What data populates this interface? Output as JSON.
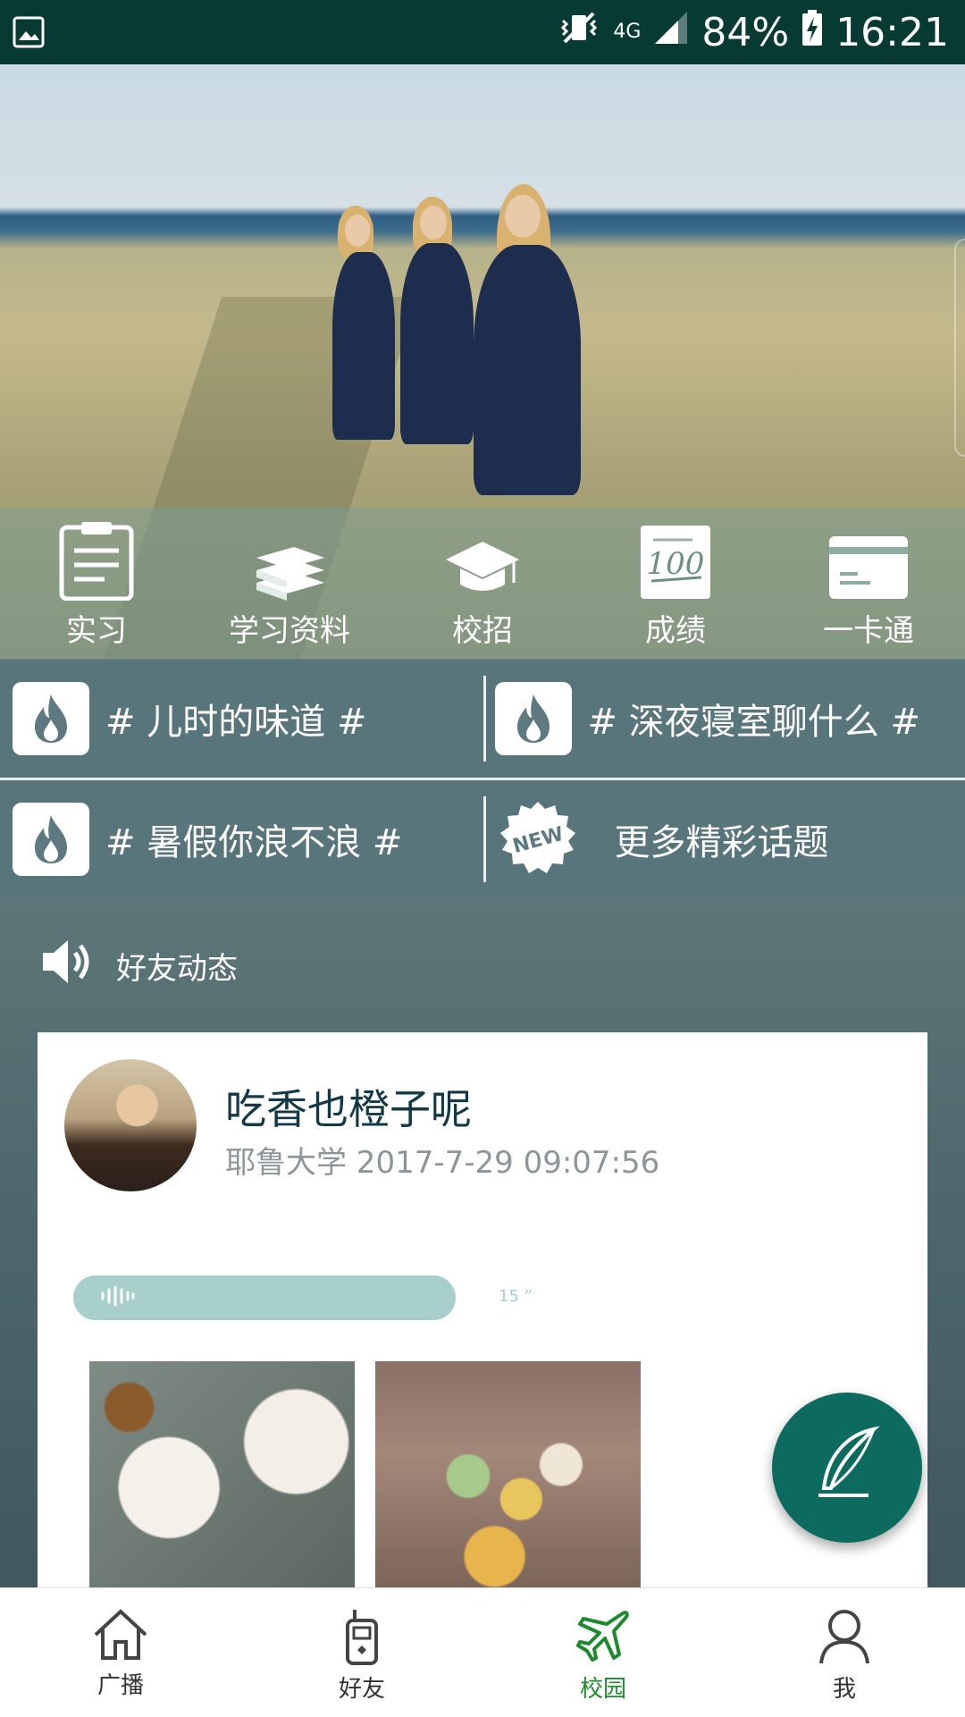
{
  "status_bar": {
    "network_small": "4G",
    "battery_percent": "84%",
    "time": "16:21"
  },
  "shortcuts": [
    {
      "label": "实习",
      "icon": "clipboard-icon"
    },
    {
      "label": "学习资料",
      "icon": "books-icon"
    },
    {
      "label": "校招",
      "icon": "graduation-cap-icon"
    },
    {
      "label": "成绩",
      "icon": "score-100-icon"
    },
    {
      "label": "一卡通",
      "icon": "card-icon"
    }
  ],
  "topics": {
    "items": [
      {
        "label": "# 儿时的味道 #",
        "icon": "fire-icon"
      },
      {
        "label": "# 深夜寝室聊什么 #",
        "icon": "fire-icon"
      },
      {
        "label": "# 暑假你浪不浪 #",
        "icon": "fire-icon"
      }
    ],
    "more_badge": "NEW",
    "more_label": "更多精彩话题"
  },
  "feed": {
    "header": "好友动态",
    "post": {
      "username": "吃香也橙子呢",
      "meta": "耶鲁大学 2017-7-29 09:07:56",
      "voice_duration": "15 “"
    }
  },
  "bottom_nav": [
    {
      "label": "广播",
      "icon": "home-icon",
      "active": false
    },
    {
      "label": "好友",
      "icon": "walkie-talkie-icon",
      "active": false
    },
    {
      "label": "校园",
      "icon": "airplane-icon",
      "active": true
    },
    {
      "label": "我",
      "icon": "person-icon",
      "active": false
    }
  ],
  "colors": {
    "status_bar": "#063a33",
    "accent_green": "#1e8a2e",
    "fab": "#0d6a5f",
    "voice_bar": "#a8cfcc"
  }
}
